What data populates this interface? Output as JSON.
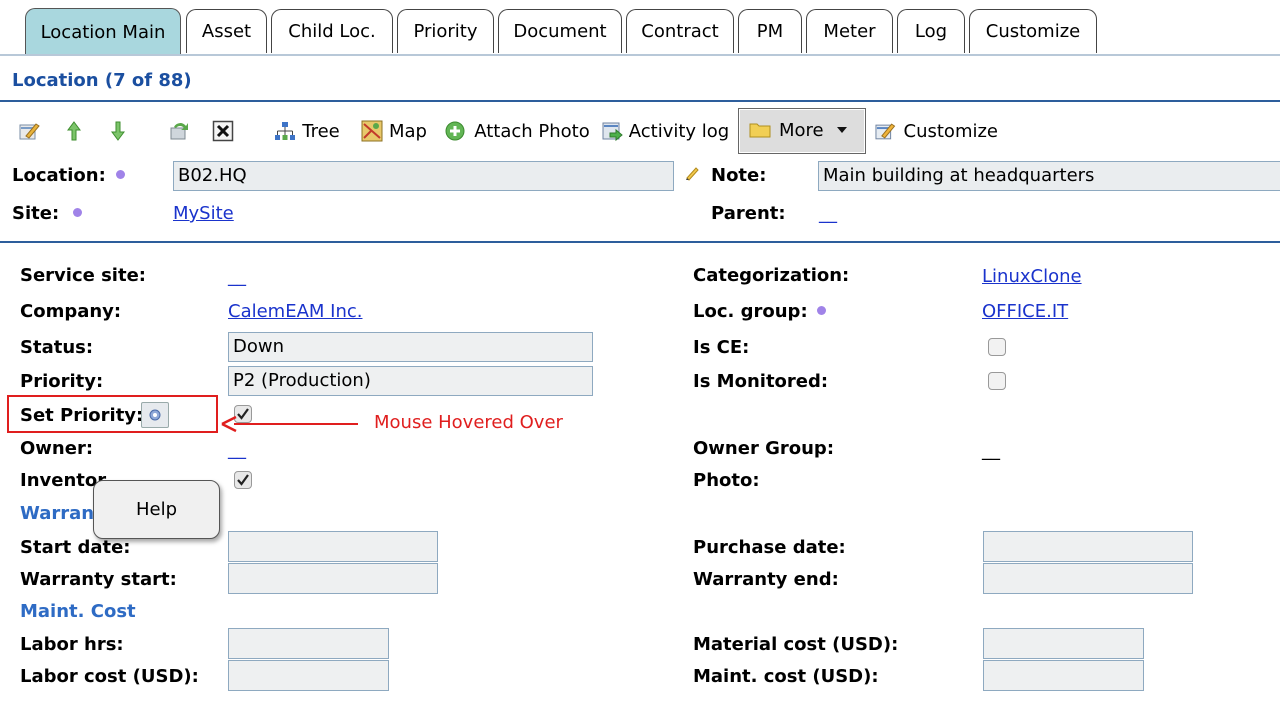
{
  "tabs": [
    {
      "label": "Location Main",
      "active": true
    },
    {
      "label": "Asset"
    },
    {
      "label": "Child Loc."
    },
    {
      "label": "Priority"
    },
    {
      "label": "Document"
    },
    {
      "label": "Contract"
    },
    {
      "label": "PM"
    },
    {
      "label": "Meter"
    },
    {
      "label": "Log"
    },
    {
      "label": "Customize"
    }
  ],
  "page_title": "Location (7 of 88)",
  "toolbar": {
    "tree": "Tree",
    "map": "Map",
    "attach_photo": "Attach Photo",
    "activity_log": "Activity log",
    "more": "More",
    "customize": "Customize"
  },
  "header": {
    "location_label": "Location:",
    "location_value": "B02.HQ",
    "note_label": "Note:",
    "note_value": "Main building at headquarters",
    "site_label": "Site:",
    "site_value": "MySite",
    "parent_label": "Parent:",
    "parent_value": "__"
  },
  "form": {
    "service_site_label": "Service site:",
    "service_site_value": "__",
    "company_label": "Company:",
    "company_value": "CalemEAM Inc.",
    "status_label": "Status:",
    "status_value": "Down",
    "priority_label": "Priority:",
    "priority_value": "P2 (Production)",
    "set_priority_label": "Set Priority:",
    "set_priority_checked": true,
    "owner_label": "Owner:",
    "owner_value": "__",
    "inventory_label": "Inventor",
    "inventory_checked": true,
    "warranty_section": "Warrant",
    "start_date_label": "Start date:",
    "warranty_start_label": "Warranty start:",
    "maint_cost_section": "Maint. Cost",
    "labor_hrs_label": "Labor hrs:",
    "labor_cost_label": "Labor cost (USD):",
    "categorization_label": "Categorization:",
    "categorization_value": "LinuxClone",
    "loc_group_label": "Loc. group:",
    "loc_group_value": "OFFICE.IT",
    "is_ce_label": "Is CE:",
    "is_monitored_label": "Is Monitored:",
    "owner_group_label": "Owner Group:",
    "owner_group_value": "__",
    "photo_label": "Photo:",
    "purchase_date_label": "Purchase date:",
    "warranty_end_label": "Warranty end:",
    "material_cost_label": "Material cost (USD):",
    "maint_cost_label": "Maint. cost (USD):"
  },
  "tooltip": "Help",
  "annotation": "Mouse Hovered Over",
  "colors": {
    "accent": "#1b4fa0",
    "tab_active": "#a9d7de",
    "annotation": "#e01e1e",
    "dot": "#a083e8"
  }
}
